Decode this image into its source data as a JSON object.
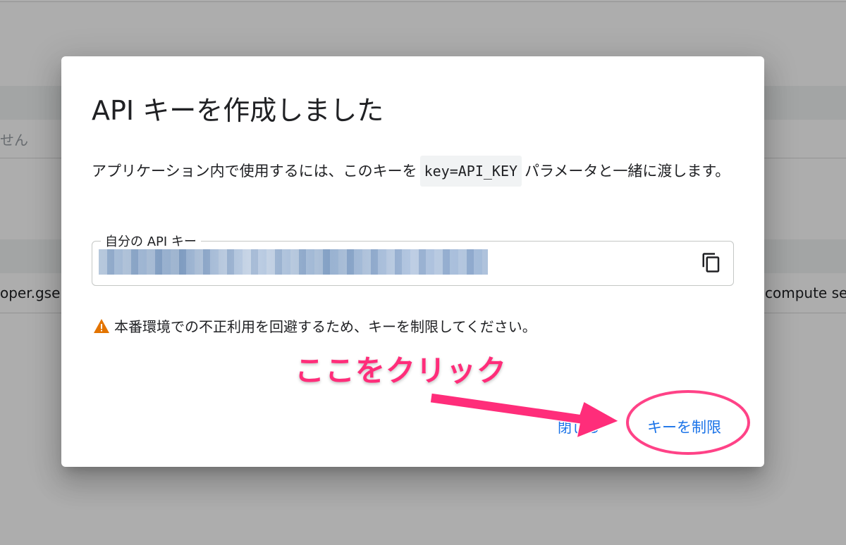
{
  "background": {
    "fragment_left_1": "せん",
    "fragment_left_2": "oper.gse",
    "fragment_right": "compute se"
  },
  "dialog": {
    "title": "API キーを作成しました",
    "description_before": "アプリケーション内で使用するには、このキーを",
    "description_code": "key=API_KEY",
    "description_after": "パラメータと一緒に渡します。",
    "key_field_label": "自分の API キー",
    "copy_icon": "copy-icon",
    "warning_icon": "warning-icon",
    "warning_text": "本番環境での不正利用を回避するため、キーを制限してください。",
    "close_label": "閉じる",
    "restrict_label": "キーを制限"
  },
  "annotation": {
    "callout_text": "ここをクリック",
    "color": "#ff2d7a"
  },
  "colors": {
    "accent": "#1a73e8",
    "warning": "#e37400"
  }
}
